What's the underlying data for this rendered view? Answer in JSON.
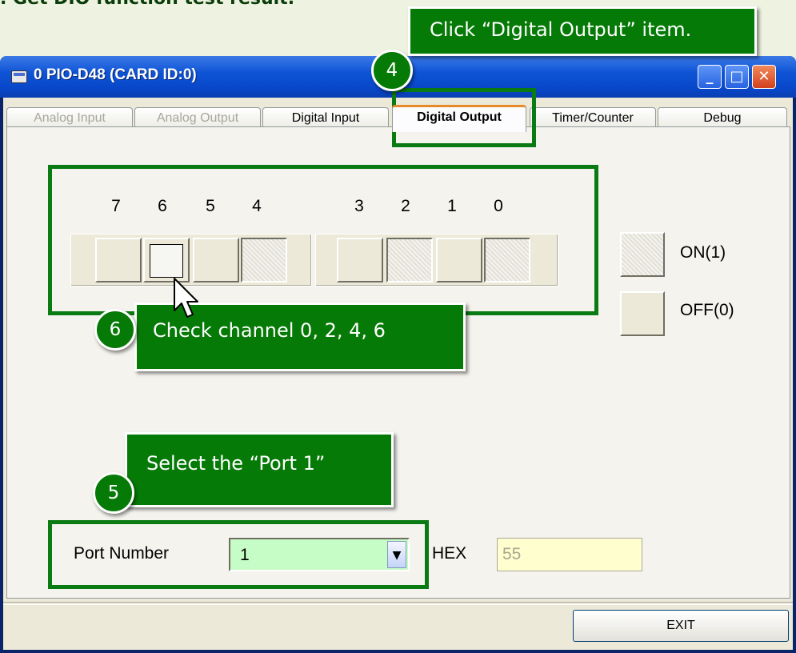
{
  "heading": ". Get DIO function test result.",
  "window": {
    "title": "0 PIO-D48 (CARD ID:0)",
    "minimize_glyph": "_",
    "maximize_glyph": "□",
    "close_glyph": "✕"
  },
  "tabs": [
    {
      "label": "Analog Input",
      "state": "disabled"
    },
    {
      "label": "Analog Output",
      "state": "disabled"
    },
    {
      "label": "Digital Input",
      "state": "normal"
    },
    {
      "label": "Digital Output",
      "state": "active"
    },
    {
      "label": "Timer/Counter",
      "state": "normal"
    },
    {
      "label": "Debug",
      "state": "normal"
    }
  ],
  "bits": {
    "labels": [
      "7",
      "6",
      "5",
      "4",
      "3",
      "2",
      "1",
      "0"
    ]
  },
  "legend": {
    "on_label": "ON(1)",
    "off_label": "OFF(0)"
  },
  "port": {
    "label": "Port Number",
    "value": "1",
    "arrow_glyph": "▼"
  },
  "hex": {
    "label": "HEX",
    "value": "55"
  },
  "exit_label": "EXIT",
  "annotations": {
    "callout_4": "Click “Digital Output” item.",
    "badge_4": "4",
    "callout_6": "Check channel 0, 2, 4, 6",
    "badge_6": "6",
    "callout_5": "Select the “Port 1”",
    "badge_5": "5"
  },
  "colors": {
    "annotation_green": "#067a06",
    "combo_bg": "#c6fcc6",
    "hex_bg": "#fefece"
  }
}
